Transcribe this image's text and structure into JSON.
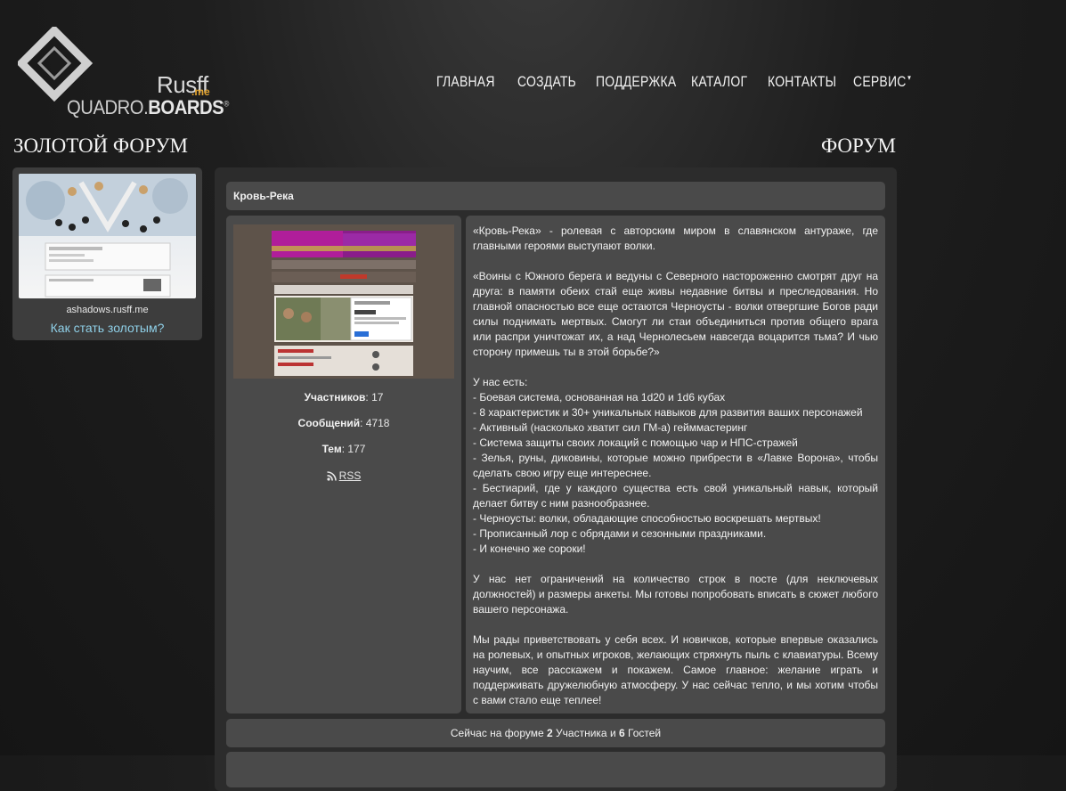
{
  "logo": {
    "rusff": "Rusff",
    "me": ".me",
    "quadro": "QUADRO.",
    "boards": "BOARDS",
    "reg": "®"
  },
  "nav": [
    {
      "label": "ГЛАВНАЯ"
    },
    {
      "label": "СОЗДАТЬ"
    },
    {
      "label": "ПОДДЕРЖКА"
    },
    {
      "label": "КАТАЛОГ"
    },
    {
      "label": "КОНТАКТЫ"
    },
    {
      "label": "СЕРВИС"
    }
  ],
  "headings": {
    "left": "ЗОЛОТОЙ ФОРУМ",
    "right": "ФОРУМ"
  },
  "gold": {
    "url": "ashadows.rusff.me",
    "link": "Как стать золотым?"
  },
  "forum": {
    "title": "Кровь-Река",
    "stats": {
      "members_label": "Участников",
      "members": "17",
      "posts_label": "Сообщений",
      "posts": "4718",
      "topics_label": "Тем",
      "topics": "177"
    },
    "rss": "RSS",
    "description": {
      "p1": "«Кровь-Река» - ролевая с авторским миром в славянском антураже, где главными героями выступают волки.",
      "p2": "«Воины с Южного берега и ведуны с Северного настороженно смотрят друг на друга: в памяти обеих стай еще живы недавние битвы и преследования. Но главной опасностью все еще остаются Черноусты - волки отвергшие Богов ради силы поднимать мертвых. Смогут ли стаи объединиться против общего врага или распри уничтожат их, а над Чернолесьем навсегда воцарится тьма? И чью сторону примешь ты в этой борьбе?»",
      "list_title": "У нас есть:",
      "items": [
        "- Боевая система, основанная на 1d20 и 1d6 кубах",
        "- 8 характеристик и 30+ уникальных навыков для развития ваших персонажей",
        "- Активный (насколько хватит сил ГМ-а) гейммастеринг",
        "- Система защиты своих локаций с помощью чар и НПС-стражей",
        "- Зелья, руны, диковины, которые можно прибрести в «Лавке Ворона», чтобы сделать свою игру еще интереснее.",
        "- Бестиарий, где у каждого существа есть свой уникальный навык, который делает битву с ним разнообразнее.",
        "- Черноусты: волки, обладающие способностью воскрешать мертвых!",
        "- Прописанный лор с обрядами и сезонными праздниками.",
        "- И конечно же сороки!"
      ],
      "p3": "У нас нет ограничений на количество строк в посте (для неключевых должностей) и размеры анкеты. Мы готовы попробовать вписать в сюжет любого вашего персонажа.",
      "p4": "Мы рады приветствовать у себя всех. И новичков, которые впервые оказались на ролевых, и опытных игроков, желающих стряхнуть пыль с клавиатуры. Всему научим, все расскажем и покажем. Самое главное: желание играть и поддерживать дружелюбную атмосферу. У нас сейчас тепло, и мы хотим чтобы с вами стало еще теплее!"
    },
    "online": {
      "prefix": "Сейчас на форуме",
      "members": "2",
      "members_label": "Участника",
      "and": "и",
      "guests": "6",
      "guests_label": "Гостей"
    }
  },
  "colors": {
    "background": "#1e1e1e",
    "panel": "#2c2c2c",
    "card": "#4a4a4a",
    "link": "#8fd0e8",
    "accent": "#e2a32f"
  }
}
